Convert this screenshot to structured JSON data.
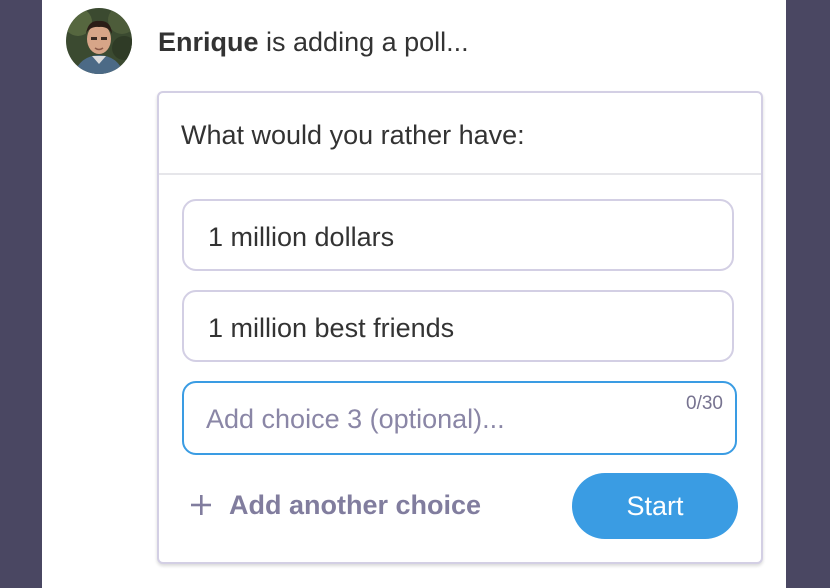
{
  "author": {
    "name": "Enrique",
    "action": " is adding a poll..."
  },
  "poll": {
    "question": "What would you rather have:",
    "choices": [
      {
        "label": "1 million dollars"
      },
      {
        "label": "1 million best friends"
      }
    ],
    "new_choice": {
      "value": "",
      "placeholder": "Add choice 3 (optional)...",
      "char_count": "0/30"
    },
    "add_choice_label": "Add another choice",
    "start_label": "Start"
  },
  "colors": {
    "accent": "#3a9ce3",
    "border": "#d3cfe4",
    "background": "#4a4762"
  },
  "icons": {
    "avatar": "user-avatar-photo",
    "add": "plus-icon"
  }
}
